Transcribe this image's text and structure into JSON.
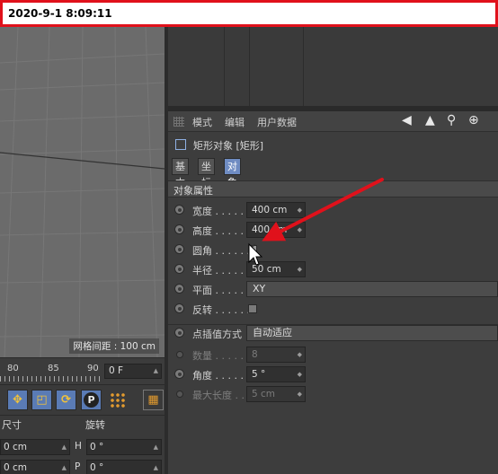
{
  "timestamp": "2020-9-1 8:09:11",
  "viewport": {
    "grid_spacing": "网格间距 : 100 cm"
  },
  "timeline": {
    "ticks": [
      "80",
      "85",
      "90"
    ],
    "frame": "0 F"
  },
  "coords": {
    "size_header": "尺寸",
    "rotation_header": "旋转",
    "rows": [
      {
        "value": "0 cm",
        "axis": "H",
        "rot": "0 °"
      },
      {
        "value": "0 cm",
        "axis": "P",
        "rot": "0 °"
      }
    ]
  },
  "toolbar": {
    "icons": [
      "move-arrows-icon",
      "scale-icon",
      "rotate-icon",
      "point-mode-icon",
      "grid-dots-icon",
      "filmstrip-icon"
    ],
    "point_label": "P"
  },
  "attributes": {
    "menu": [
      "模式",
      "编辑",
      "用户数据"
    ],
    "object_title": "矩形对象 [矩形]",
    "tabs": [
      "基本",
      "坐标",
      "对象"
    ],
    "active_tab": "对象",
    "section": "对象属性",
    "props": [
      {
        "label": "宽度 . . . . . . .",
        "value": "400 cm"
      },
      {
        "label": "高度 . . . . . . .",
        "value": "400 cm"
      },
      {
        "label": "圆角 . . . . . . .",
        "checked": true
      },
      {
        "label": "半径 . . . . . . .",
        "value": "50 cm"
      },
      {
        "label": "平面 . . . . . . .",
        "value": "XY"
      },
      {
        "label": "反转 . . . . . . .",
        "checked": false
      }
    ],
    "interp": [
      {
        "label": "点插值方式",
        "value": "自动适应"
      },
      {
        "label": "数量 . . . . . . .",
        "value": "8"
      },
      {
        "label": "角度 . . . . . . .",
        "value": "5 °"
      },
      {
        "label": "最大长度 . . . .",
        "value": "5 cm"
      }
    ]
  },
  "annotation": {
    "color": "#e0111b"
  }
}
